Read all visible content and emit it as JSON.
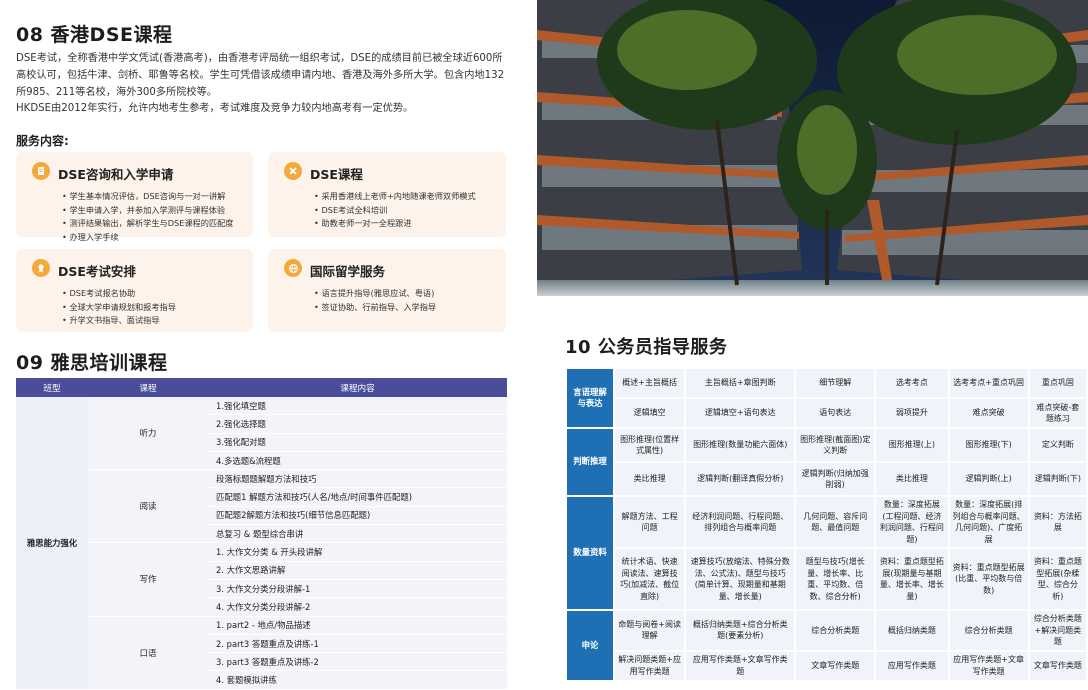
{
  "dse": {
    "title": "08 香港DSE课程",
    "para1": "DSE考试，全称香港中学文凭试(香港高考)，由香港考评局统一组织考试，DSE的成绩目前已被全球近600所高校认可，包括牛津、剑桥、耶鲁等名校。学生可凭借该成绩申请内地、香港及海外多所大学。包含内地132所985、211等名校，海外300多所院校等。",
    "para2": "HKDSE由2012年实行，允许内地考生参考，考试难度及竞争力较内地高考有一定优势。",
    "services_label": "服务内容:",
    "cards": [
      {
        "title": "DSE咨询和入学申请",
        "icon": "document-icon",
        "items": [
          "学生基本情况评估，DSE咨询与一对一讲解",
          "学生申请入学，并参加入学测评与课程体验",
          "测评结果输出，解析学生与DSE课程的匹配度",
          "办理入学手续"
        ]
      },
      {
        "title": "DSE课程",
        "icon": "tools-icon",
        "items": [
          "采用香港线上老师+内地随课老师双师模式",
          "DSE考试全科培训",
          "助教老师一对一全程跟进"
        ]
      },
      {
        "title": "DSE考试安排",
        "icon": "medal-icon",
        "items": [
          "DSE考试报名协助",
          "全球大学申请规划和报考指导",
          "升学文书指导、面试指导"
        ]
      },
      {
        "title": "国际留学服务",
        "icon": "globe-icon",
        "items": [
          "语言提升指导(雅思应试、粤语)",
          "签证协助、行前指导、入学指导"
        ]
      }
    ],
    "accent": "#f3a93c",
    "card_bg": "#fdf3ea"
  },
  "ielts": {
    "title": "09 雅思培训课程",
    "headers": [
      "班型",
      "课程",
      "课程内容"
    ],
    "class_name": "雅思能力强化",
    "header_color": "#4a4d9a",
    "groups": [
      {
        "course": "听力",
        "contents": [
          "1.强化填空题",
          "2.强化选择题",
          "3.强化配对题",
          "4.多选题&流程题"
        ]
      },
      {
        "course": "阅读",
        "contents": [
          "段落标题题解题方法和技巧",
          "匹配题1 解题方法和技巧(人名/地点/时间事件匹配题)",
          "匹配题2解题方法和技巧(细节信息匹配题)",
          "总复习 & 题型综合串讲"
        ]
      },
      {
        "course": "写作",
        "contents": [
          "1. 大作文分类 & 开头段讲解",
          "2. 大作文思路讲解",
          "3. 大作文分类分段讲解-1",
          "4. 大作文分类分段讲解-2"
        ]
      },
      {
        "course": "口语",
        "contents": [
          "1. part2 - 地点/物品描述",
          "2. part3 答题重点及讲练-1",
          "3. part3 答题重点及讲练-2",
          "4. 套题模拟讲练"
        ]
      }
    ]
  },
  "civil": {
    "title": "10 公务员指导服务",
    "cat_color": "#1f6fb5",
    "sections": [
      {
        "category": "言语理解与表达",
        "rows": [
          [
            "概述+主旨概括",
            "主旨概括+章图判断",
            "细节理解",
            "选考考点",
            "选考考点+重点巩固",
            "重点巩固"
          ],
          [
            "逻辑填空",
            "逻辑填空+语句表达",
            "语句表达",
            "弱项提升",
            "难点突破",
            "难点突破-套题练习"
          ]
        ]
      },
      {
        "category": "判断推理",
        "rows": [
          [
            "图形推理(位置样式属性)",
            "图形推理(数量功能六面体)",
            "图形推理(截面图)定义判断",
            "图形推理(上)",
            "图形推理(下)",
            "定义判断"
          ],
          [
            "类比推理",
            "逻辑判断(翻译真假分析)",
            "逻辑判断(归纳加强削弱)",
            "类比推理",
            "逻辑判断(上)",
            "逻辑判断(下)"
          ]
        ]
      },
      {
        "category": "数量资料",
        "rows": [
          [
            "解题方法、工程问题",
            "经济利润问题、行程问题、排列组合与概率问题",
            "几何问题、容斥问题、最值问题",
            "数量：深度拓展(工程问题、经济利润问题、行程问题)",
            "数量：深度拓展(排列组合与概率问题、几何问题)、广度拓展",
            "资料：方法拓展"
          ],
          [
            "统计术语、快速阅读法、速算技巧(加减法、截位直除)",
            "速算技巧(放缩法、特殊分数法、公式法)、题型与技巧(简单计算、现期量和基期量、增长量)",
            "题型与技巧(增长量、增长率、比重、平均数、倍数、综合分析)",
            "资料：重点题型拓展(现期量与基期量、增长率、增长量)",
            "资料：重点题型拓展(比重、平均数与倍数)",
            "资料：重点题型拓展(杂糅型、综合分析)"
          ]
        ]
      },
      {
        "category": "申论",
        "rows": [
          [
            "命题与阅卷+阅读理解",
            "概括归纳类题+综合分析类题(要素分析)",
            "综合分析类题",
            "概括归纳类题",
            "综合分析类题",
            "综合分析类题+解决问题类题"
          ],
          [
            "解决问题类题+应用写作类题",
            "应用写作类题+文章写作类题",
            "文章写作类题",
            "应用写作类题",
            "应用写作类题+文章写作类题",
            "文章写作类题"
          ]
        ]
      }
    ]
  }
}
